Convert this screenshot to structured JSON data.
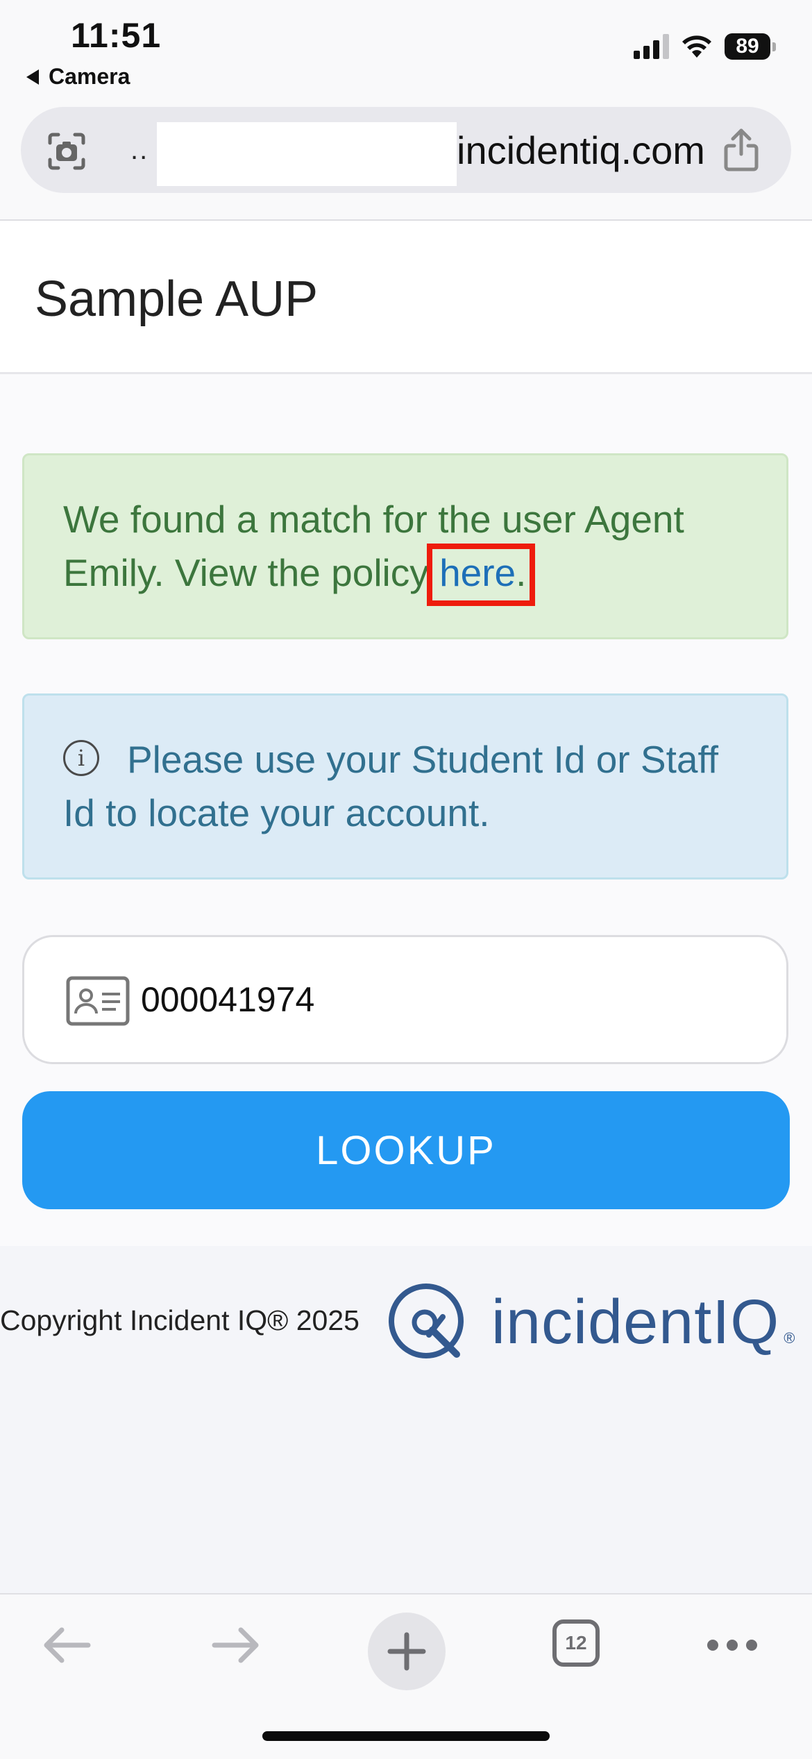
{
  "status_bar": {
    "time": "11:51",
    "back_app": "Camera",
    "battery": "89"
  },
  "address_bar": {
    "prefix": "..",
    "domain": "incidentiq.com"
  },
  "page": {
    "title": "Sample AUP"
  },
  "success_alert": {
    "text": "We found a match for the user Agent Emily. View the policy ",
    "link_label": "here",
    "suffix": "."
  },
  "info_alert": {
    "text": "Please use your Student Id or Staff Id to locate your account."
  },
  "id_input": {
    "value": "000041974"
  },
  "lookup_button": {
    "label": "LOOKUP"
  },
  "footer": {
    "copyright": "Copyright Incident IQ® 2025",
    "logo_text": "incidentIQ",
    "logo_reg": "®"
  },
  "toolbar": {
    "tab_count": "12"
  },
  "colors": {
    "accent": "#2499f2",
    "success_bg": "#dff0d8",
    "success_text": "#3c763d",
    "info_bg": "#dcebf6",
    "info_text": "#31708f",
    "highlight_box": "#ee1c0c",
    "brand": "#33598f"
  }
}
